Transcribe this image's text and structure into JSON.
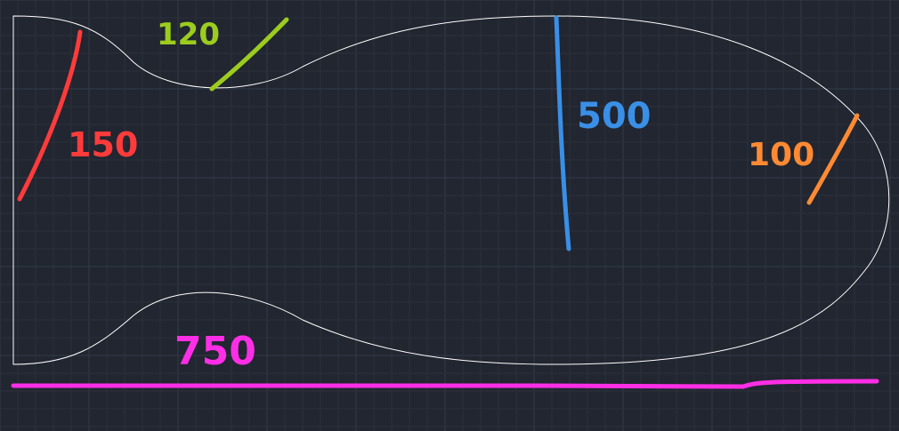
{
  "colors": {
    "background": "#212630",
    "grid_minor": "#2a303b",
    "grid_major": "#343b47",
    "outline": "#ffffff",
    "red": "#ff3b3b",
    "green": "#9ccc1e",
    "blue": "#3a8fe6",
    "orange": "#ff8a33",
    "magenta": "#ff2ee6"
  },
  "dimensions": {
    "neck_height": "150",
    "neck_arc": "120",
    "body_height": "500",
    "tip_radius": "100",
    "total_length": "750"
  }
}
